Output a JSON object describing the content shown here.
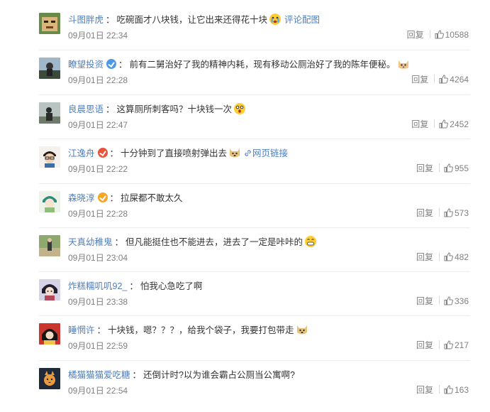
{
  "comments": [
    {
      "user": "斗图胖虎",
      "badge": "",
      "text": "吃碗面才八块钱，让它出来还得花十块",
      "emoji": "crying-face",
      "link": "评论配图",
      "time": "09月01日 22:34",
      "reply": "回复",
      "likes": "10588"
    },
    {
      "user": "瞭望投资",
      "badge": "blue",
      "text": "前有二舅治好了我的精神内耗，现有移动公厕治好了我的陈年便秘。",
      "emoji": "cat-face",
      "link": "",
      "time": "09月01日 22:28",
      "reply": "回复",
      "likes": "4264"
    },
    {
      "user": "良晨思语",
      "badge": "",
      "text": "这算厕所刺客吗？十块钱一次",
      "emoji": "shocked-face",
      "link": "",
      "time": "09月01日 22:47",
      "reply": "回复",
      "likes": "2452"
    },
    {
      "user": "江逸舟",
      "badge": "red",
      "text": "十分钟到了直接喷射弹出去",
      "emoji": "doge-face",
      "link": "网页链接",
      "time": "09月01日 22:22",
      "reply": "回复",
      "likes": "955"
    },
    {
      "user": "森晓淳",
      "badge": "orange",
      "text": "拉屎都不敢太久",
      "emoji": "",
      "link": "",
      "time": "09月01日 22:28",
      "reply": "回复",
      "likes": "573"
    },
    {
      "user": "天真幼稚鬼",
      "badge": "",
      "text": "但凡能挺住也不能进去，进去了一定是咔咔的",
      "emoji": "grin-face",
      "link": "",
      "time": "09月01日 23:04",
      "reply": "回复",
      "likes": "482"
    },
    {
      "user": "炸糕糯叽叽92_",
      "badge": "",
      "text": "怕我心急吃了啊",
      "emoji": "",
      "link": "",
      "time": "09月01日 23:38",
      "reply": "回复",
      "likes": "336"
    },
    {
      "user": "睡惘许",
      "badge": "",
      "text": "十块钱，嗯？？？，给我个袋子，我要打包带走",
      "emoji": "doge-face",
      "link": "",
      "time": "09月01日 22:59",
      "reply": "回复",
      "likes": "217"
    },
    {
      "user": "橘猫猫猫爱吃糖",
      "badge": "",
      "text": "还倒计时?以为谁会霸占公厕当公寓啊?",
      "emoji": "",
      "link": "",
      "time": "09月01日 22:54",
      "reply": "回复",
      "likes": "163"
    }
  ],
  "colors": {
    "username": "#4f7fbf",
    "text": "#333333",
    "meta": "#808080"
  }
}
